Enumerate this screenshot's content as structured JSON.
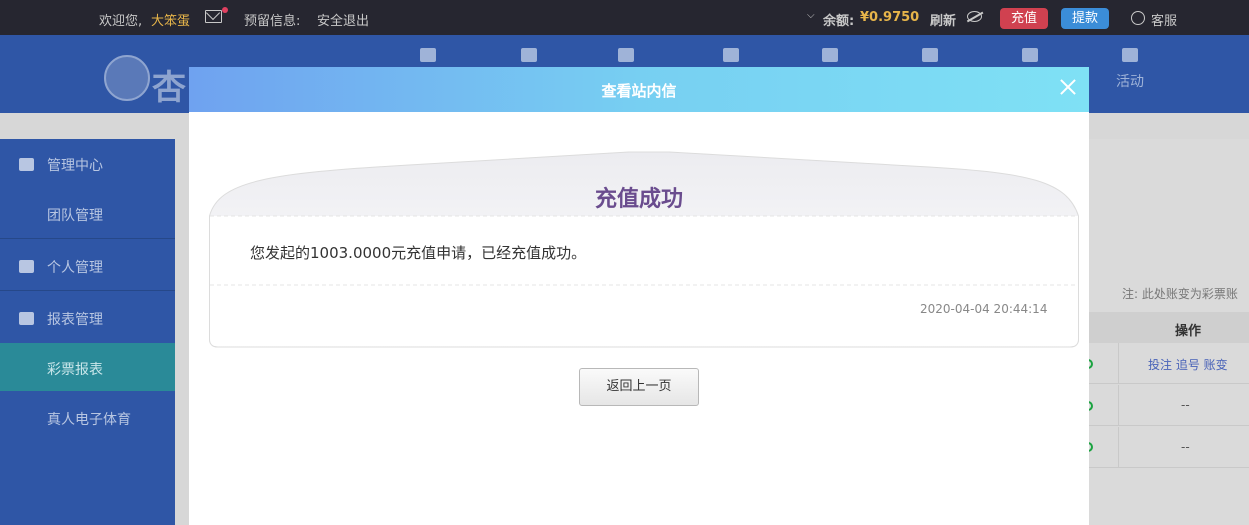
{
  "topbar": {
    "welcome": "欢迎您,",
    "username": "大笨蛋",
    "reserved_info": "预留信息:",
    "logout": "安全退出",
    "balance_label": "余额:",
    "balance_value": "¥0.9750",
    "refresh": "刷新",
    "recharge": "充值",
    "withdraw": "提款",
    "service": "客服"
  },
  "nav": {
    "logo_text": "杏",
    "items": [
      {
        "icon": "home-icon",
        "label": ""
      },
      {
        "icon": "ticket-icon",
        "label": ""
      },
      {
        "icon": "user-bag-icon",
        "label": ""
      },
      {
        "icon": "game-icon",
        "label": ""
      },
      {
        "icon": "card-icon",
        "label": ""
      },
      {
        "icon": "diamond-icon",
        "label": ""
      },
      {
        "icon": "group-icon",
        "label": ""
      },
      {
        "icon": "gift-icon",
        "label": "活动"
      }
    ]
  },
  "sidebar": {
    "items": [
      {
        "label": "管理中心",
        "icon": "group-icon"
      },
      {
        "label": "团队管理"
      },
      {
        "label": "个人管理",
        "icon": "person-icon"
      },
      {
        "label": "报表管理",
        "icon": "report-icon"
      },
      {
        "label": "彩票报表",
        "active": true
      },
      {
        "label": "真人电子体育"
      }
    ]
  },
  "background_table": {
    "note": "注: 此处账变为彩票账",
    "header": "操作",
    "rows": [
      {
        "action": "投注 追号 账变"
      },
      {
        "action": "--"
      },
      {
        "action": "--"
      }
    ]
  },
  "modal": {
    "title": "查看站内信",
    "card_title": "充值成功",
    "message": "您发起的1003.0000元充值申请，已经充值成功。",
    "time": "2020-04-04 20:44:14",
    "back_button": "返回上一页"
  }
}
